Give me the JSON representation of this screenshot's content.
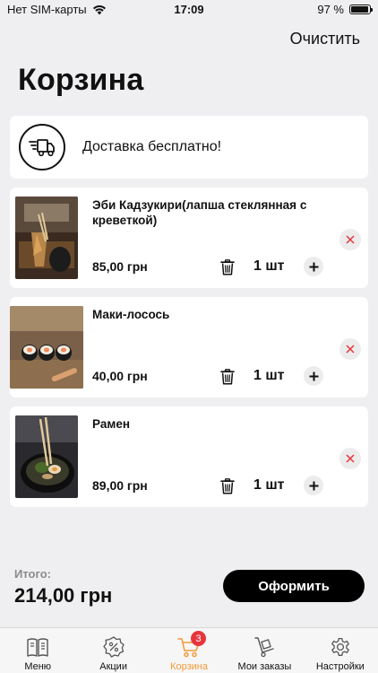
{
  "status": {
    "carrier": "Нет SIM-карты",
    "time": "17:09",
    "battery": "97 %",
    "battery_level": 0.97
  },
  "header": {
    "clear_label": "Очистить",
    "title": "Корзина"
  },
  "delivery": {
    "icon": "delivery-truck-icon",
    "text": "Доставка бесплатно!"
  },
  "items": [
    {
      "name": "Эби Кадзукири(лапша стеклянная с креветкой)",
      "price": "85,00 грн",
      "qty": "1 шт"
    },
    {
      "name": "Маки-лосось",
      "price": "40,00 грн",
      "qty": "1 шт"
    },
    {
      "name": "Рамен",
      "price": "89,00 грн",
      "qty": "1 шт"
    }
  ],
  "footer": {
    "total_label": "Итого:",
    "total_value": "214,00 грн",
    "checkout_label": "Оформить"
  },
  "tabs": [
    {
      "label": "Меню",
      "icon": "menu-book-icon"
    },
    {
      "label": "Акции",
      "icon": "discount-badge-icon"
    },
    {
      "label": "Корзина",
      "icon": "cart-icon",
      "badge": "3",
      "active": true
    },
    {
      "label": "Мои заказы",
      "icon": "hand-truck-icon"
    },
    {
      "label": "Настройки",
      "icon": "gear-icon"
    }
  ],
  "colors": {
    "accent": "#f29a38",
    "badge": "#e6353d",
    "remove": "#e6353d",
    "background": "#efeff1"
  }
}
